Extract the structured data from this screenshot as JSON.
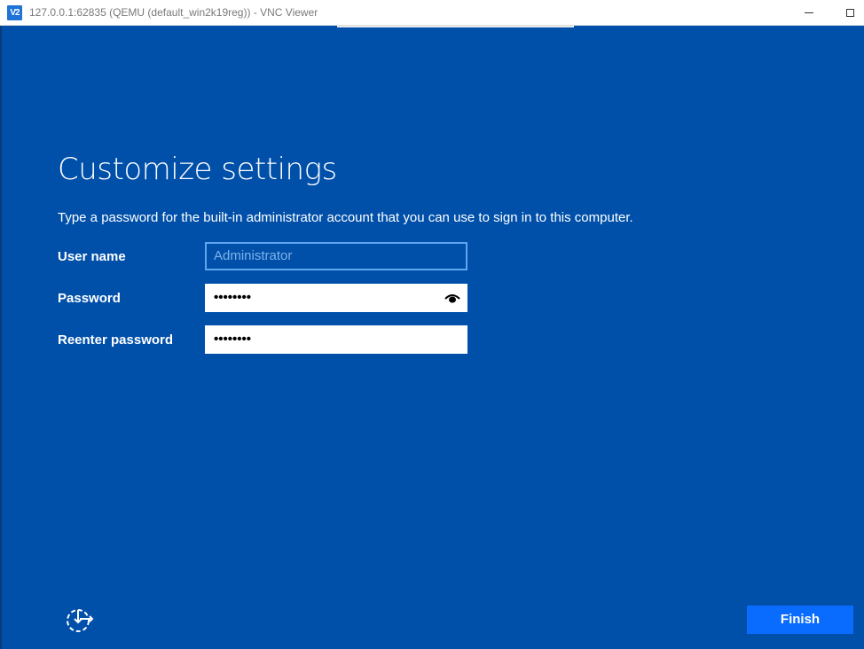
{
  "titlebar": {
    "app_icon_text": "V2",
    "title": "127.0.0.1:62835 (QEMU (default_win2k19reg)) - VNC Viewer"
  },
  "setup": {
    "title": "Customize settings",
    "description": "Type a password for the built-in administrator account that you can use to sign in to this computer.",
    "username": {
      "label": "User name",
      "placeholder": "Administrator"
    },
    "password": {
      "label": "Password",
      "value": "••••••••"
    },
    "reenter_password": {
      "label": "Reenter password",
      "value": "••••••••"
    }
  },
  "footer": {
    "finish_label": "Finish"
  },
  "colors": {
    "background": "#0050aa",
    "button": "#0a6cff",
    "focus_border": "#5fa5ef"
  },
  "icons": {
    "app": "vnc-viewer-icon",
    "minimize": "minimize-icon",
    "maximize": "maximize-icon",
    "reveal": "eye-icon",
    "accessibility": "ease-of-access-icon"
  }
}
